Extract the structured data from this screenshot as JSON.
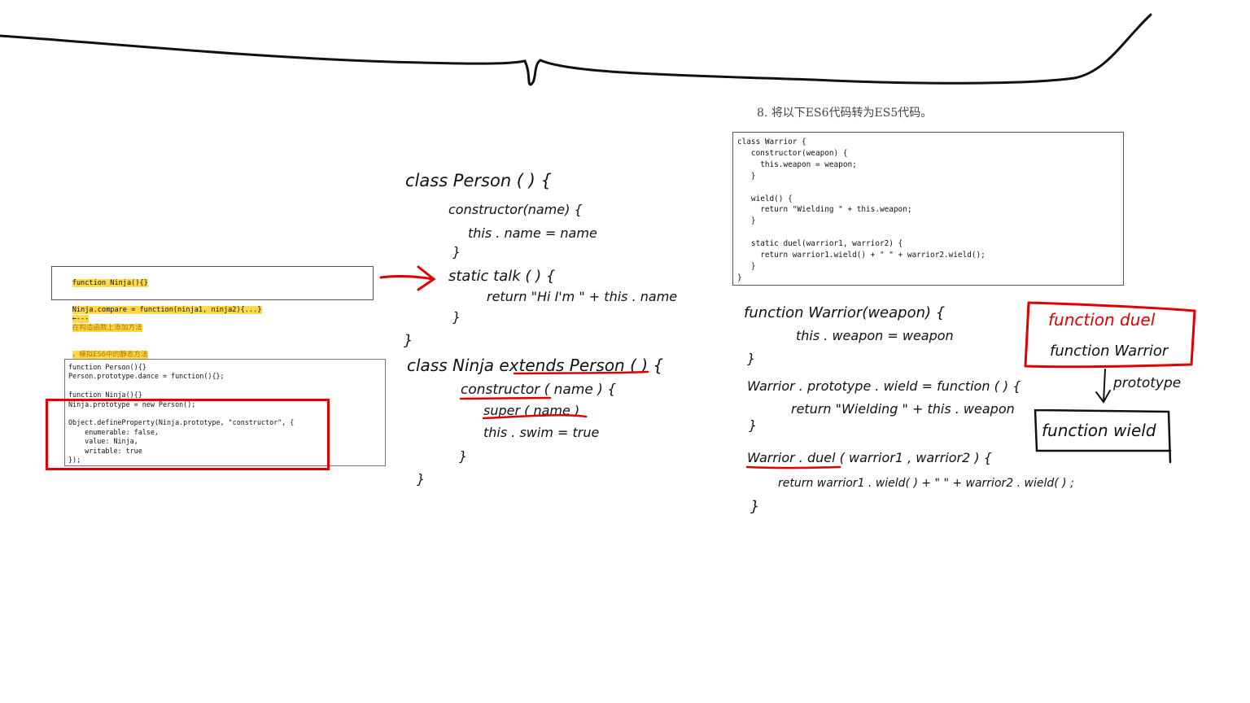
{
  "question": {
    "number": "8.",
    "text": "将以下ES6代码转为ES5代码。"
  },
  "snippet_static": {
    "line1": "function Ninja(){}",
    "line2_code": "Ninja.compare = function(ninja1, ninja2){...}",
    "line2_arrow": "←---",
    "line2_note": "在构造函数上添加方法",
    "line3": "，模拟ES6中的静态方法"
  },
  "snippet_proto": {
    "lines": [
      "function Person(){}",
      "Person.prototype.dance = function(){};",
      "",
      "function Ninja(){}",
      "Ninja.prototype = new Person();",
      "",
      "Object.defineProperty(Ninja.prototype, \"constructor\", {",
      "    enumerable: false,",
      "    value: Ninja,",
      "    writable: true",
      "});"
    ]
  },
  "warrior_code": {
    "lines": [
      "class Warrior {",
      "   constructor(weapon) {",
      "     this.weapon = weapon;",
      "   }",
      "",
      "   wield() {",
      "     return \"Wielding \" + this.weapon;",
      "   }",
      "",
      "   static duel(warrior1, warrior2) {",
      "     return warrior1.wield() + \" \" + warrior2.wield();",
      "   }",
      "}"
    ]
  },
  "handwriting": {
    "person_class": {
      "l1": "class Person ( ) {",
      "l2": "constructor(name) {",
      "l3": "this . name  =  name",
      "l4": "}",
      "l5": "static  talk ( ) {",
      "l6": "return \"Hi I'm \" + this . name",
      "l7": "}",
      "l8": "}"
    },
    "ninja_class": {
      "l1": "class Ninja extends Person ( ) {",
      "l2": "constructor ( name ) {",
      "l3": "super ( name )",
      "l4": "this . swim  =  true",
      "l5": "}",
      "l6": "}"
    },
    "warrior_es5": {
      "l1": "function Warrior(weapon) {",
      "l2": "this . weapon  =  weapon",
      "l3": "}",
      "l4": "Warrior . prototype . wield  =  function ( ) {",
      "l5": "return \"Wielding \" + this . weapon",
      "l6": "}",
      "l7": "Warrior . duel ( warrior1 , warrior2 ) {",
      "l8": "return warrior1 . wield( )  +  \" \"  +  warrior2 . wield( ) ;",
      "l9": "}"
    },
    "diagram": {
      "box1_line1": "function duel",
      "box1_line2": "function Warrior",
      "arrow_label": "prototype",
      "box2": "function wield"
    }
  },
  "colors": {
    "ink": "#111111",
    "red_ink": "#e00000",
    "highlight": "#ffd94a"
  }
}
